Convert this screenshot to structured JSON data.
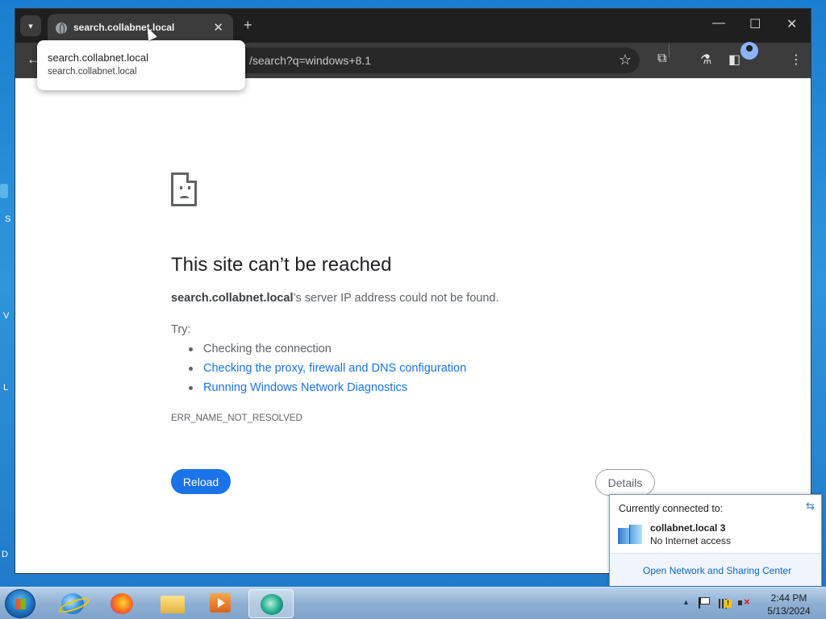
{
  "browser": {
    "tab": {
      "title": "search.collabnet.local"
    },
    "hovercard": {
      "title": "search.collabnet.local",
      "domain": "search.collabnet.local"
    },
    "omnibox": {
      "url_visible": "/search?q=windows+8.1"
    },
    "icons": {
      "tab_search": "chevron-down-icon",
      "tab_close": "close-icon",
      "new_tab": "plus-icon",
      "back": "back-arrow-icon",
      "bookmark": "star-icon",
      "extensions": "puzzle-icon",
      "labs": "flask-icon",
      "side_panel": "side-panel-icon",
      "profile": "avatar-icon",
      "menu": "more-vert-icon"
    },
    "window_controls": {
      "minimize": "—",
      "maximize": "☐",
      "close": "✕"
    }
  },
  "error_page": {
    "title": "This site can’t be reached",
    "host": "search.collabnet.local",
    "message_suffix": "’s server IP address could not be found.",
    "try_label": "Try:",
    "suggestions": [
      "Checking the connection",
      "Checking the proxy, firewall and DNS configuration",
      "Running Windows Network Diagnostics"
    ],
    "error_code": "ERR_NAME_NOT_RESOLVED",
    "reload_label": "Reload",
    "details_label": "Details",
    "colors": {
      "primary": "#1a73e8",
      "text": "#202124",
      "secondary": "#5f6368"
    }
  },
  "network_flyout": {
    "header": "Currently connected to:",
    "network_name": "collabnet.local  3",
    "network_status": "No Internet access",
    "footer_link": "Open Network and Sharing Center"
  },
  "taskbar": {
    "clock_time": "2:44 PM",
    "clock_date": "5/13/2024",
    "apps": [
      "internet-explorer",
      "firefox",
      "file-explorer",
      "media-player",
      "teal-app"
    ]
  },
  "desktop": {
    "peek_labels": [
      "S",
      "V",
      "L",
      "D"
    ]
  }
}
